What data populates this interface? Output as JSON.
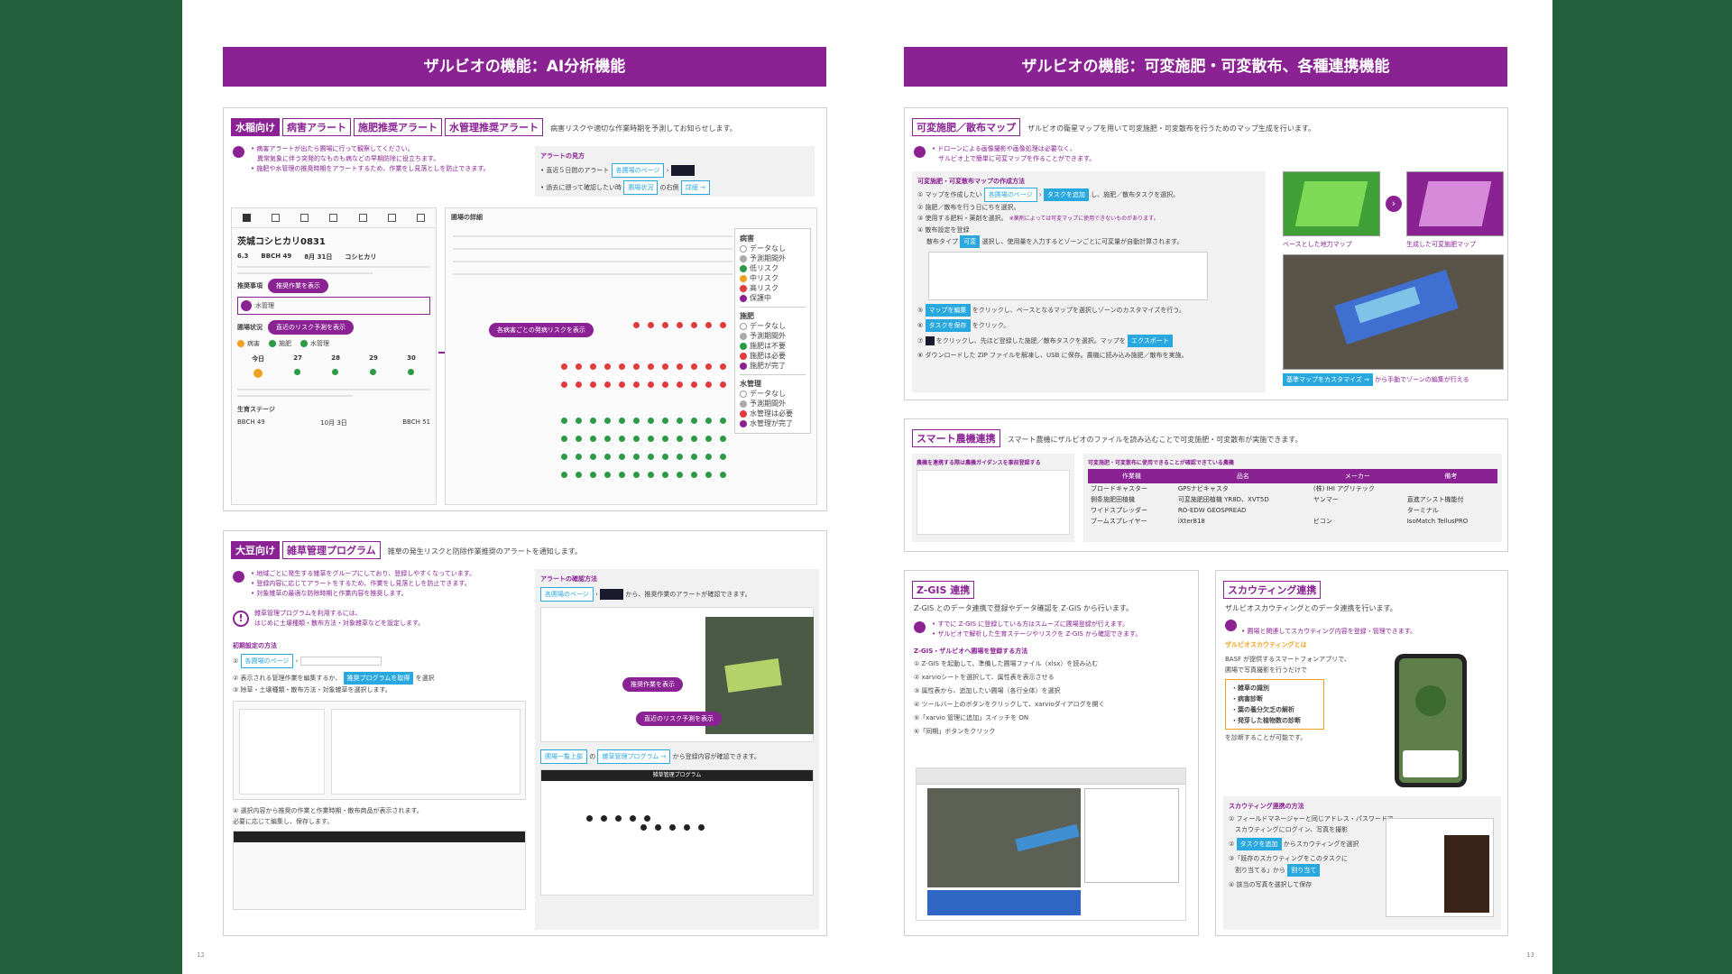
{
  "left": {
    "banner": "ザルビオの機能：AI分析機能",
    "rice": {
      "tags": [
        "水稲向け",
        "病害アラート",
        "施肥推奨アラート",
        "水管理推奨アラート"
      ],
      "desc": "病害リスクや適切な作業時期を予測してお知らせします。",
      "bullets": [
        "• 病害アラートが出たら圃場に行って観察してください。",
        "　異常気象に伴う突発的なものも病などの早期防除に役立ちます。",
        "• 施肥や水管理の推奨時期をアラートするため、作業をし見落としを防止できます。"
      ],
      "alert_title": "アラートの見方",
      "alert_step1": "• 直近５日間のアラート",
      "alert_step1_btn": "各圃場のページ",
      "alert_step2": "• 過去に遡って確認したい時",
      "alert_step2_btn": "圃場状況",
      "alert_step2_mid": "の右側",
      "alert_step2_btn2": "詳細 →",
      "phone": {
        "field_name": "茨城コシヒカリ0831",
        "stats": [
          "6.3",
          "BBCH 49",
          "8月 31日",
          "コシヒカリ"
        ],
        "section1": "推奨事項",
        "pill1": "推奨作業を表示",
        "task": "水管理",
        "section2": "圃場状況",
        "pill2": "直近のリスク予測を表示",
        "tabs": [
          "病害",
          "施肥",
          "水管理"
        ],
        "days": [
          "今日",
          "27",
          "28",
          "29",
          "30"
        ],
        "stage_title": "生育ステージ",
        "stage_left": "BBCH 49",
        "stage_right": "BBCH 51",
        "stage_date": "10月 3日"
      },
      "grid_title": "圃場の詳細",
      "grid_pill": "各病害ごとの発病リスクを表示",
      "legend": {
        "disease_title": "病害",
        "disease_items": [
          "データなし",
          "予測期間外",
          "低リスク",
          "中リスク",
          "高リスク",
          "保護中"
        ],
        "fert_title": "施肥",
        "fert_items": [
          "データなし",
          "予測期間外",
          "施肥は不要",
          "施肥は必要",
          "施肥が完了"
        ],
        "water_title": "水管理",
        "water_items": [
          "データなし",
          "予測期間外",
          "水管理は必要",
          "水管理が完了"
        ]
      }
    },
    "soy": {
      "tags": [
        "大豆向け",
        "雑草管理プログラム"
      ],
      "desc": "雑草の発生リスクと防除作業推奨のアラートを通知します。",
      "bullets": [
        "• 地域ごとに発生する雑草をグループにしており、登録しやすくなっています。",
        "• 登録内容に応じてアラートをするため、作業をし見落としを防止できます。",
        "• 対象雑草の最適な防除時期と作業内容を推奨します。"
      ],
      "warn_title": "雑草管理プログラムを利用するには、",
      "warn_body": "はじめに土壌種類・散布方法・対象雑草などを設定します。",
      "setup_title": "初期設定の方法",
      "step1_btn": "各圃場のページ",
      "step2": "② 表示される管理作業を編集するか、",
      "step2_btn": "推奨プログラムを取得",
      "step2_end": "を選択",
      "step3": "③ 除草・土壌種類・散布方法・対象雑草を選択します。",
      "step4": "④ 選択内容から推奨の作業と作業時期・散布商品が表示されます。",
      "step4b": "必要に応じて編集し、保存します。",
      "confirm_title": "アラートの確認方法",
      "confirm_btn": "各圃場のページ",
      "confirm_text": "から、推奨作業のアラートが確認できます。",
      "pill_a": "推奨作業を表示",
      "pill_b": "直近のリスク予測を表示",
      "list_btn": "圃場一覧上部",
      "list_btn2": "雑草管理プログラム →",
      "list_text": "から登録内容が確認できます。",
      "modal_title": "雑草管理プログラム",
      "page": "12"
    }
  },
  "right": {
    "banner": "ザルビオの機能：可変施肥・可変散布、各種連携機能",
    "vrt": {
      "tags": [
        "可変施肥／散布マップ"
      ],
      "desc": "ザルビオの衛星マップを用いて可変施肥・可変散布を行うためのマップ生成を行います。",
      "bullets": [
        "• ドローンによる画像撮影や画像処理は必要なく、",
        "　ザルビオ上で簡単に可変マップを作ることができます。"
      ],
      "how_title": "可変施肥・可変散布マップの作成方法",
      "s1": "① マップを作成したい",
      "s1_btn": "各圃場のページ",
      "s1_btn2": "タスクを追加",
      "s1_end": "し、施肥／散布タスクを選択。",
      "s2": "② 施肥／散布を行う日にちを選択。",
      "s3": "③ 使用する肥料・薬剤を選択。",
      "s3_note": "※薬剤によっては可変マップに使用できないものがあります。",
      "s4": "④ 散布設定を登録",
      "s4b": "散布タイプ",
      "s4_btn": "可変",
      "s4_end": "選択し、使用量を入力するとゾーンごとに可変量が自動計算されます。",
      "s5_btn": "マップを編集",
      "s5": "をクリックし、ベースとなるマップを選択しゾーンのカスタマイズを行う。",
      "s6_btn": "タスクを保存",
      "s6": "をクリック。",
      "s7": "をクリックし、先ほど登録した施肥／散布タスクを選択。マップを",
      "s7_btn": "エクスポート",
      "s8": "⑧ ダウンロードした ZIP ファイルを解凍し、USB に保存。農機に読み込み施肥／散布を実施。",
      "cap1": "ベースとした地力マップ",
      "cap2": "生成した可変施肥マップ",
      "cust_btn": "基準マップをカスタマイズ →",
      "cust_text": "から手動でゾーンの編集が行える"
    },
    "smart": {
      "tag": "スマート農機連携",
      "desc": "スマート農機にザルビオのファイルを読み込むことで可変施肥・可変散布が実施できます。",
      "left_title": "農機を連携する際は農機ガイダンスを事前登録する",
      "table_title": "可変施肥・可変散布に使用できることが確認できている農機",
      "headers": [
        "作業機",
        "品名",
        "メーカー",
        "備考"
      ],
      "rows": [
        [
          "ブロードキャスター",
          "GPSナビキャスタ",
          "(株) IHI アグリテック",
          ""
        ],
        [
          "側条施肥田植機",
          "可変施肥田植機 YR8D、XVT5D",
          "ヤンマー",
          "直進アシスト機能付"
        ],
        [
          "ワイドスプレッダー",
          "RO-EDW GEOSPREAD",
          "",
          "ターミナル"
        ],
        [
          "ブームスプレイヤー",
          "iXter818",
          "ビコン",
          "IsoMatch TellusPRO"
        ]
      ]
    },
    "zgis": {
      "tag": "Z-GIS 連携",
      "desc": "Z-GIS とのデータ連携で登録やデータ確認を Z-GIS から行います。",
      "bullets": [
        "• すでに Z-GIS に登録している方はスムーズに圃場登録が行えます。",
        "• ザルビオで解析した生育ステージやリスクを Z-GIS から確認できます。"
      ],
      "how_title": "Z-GIS・ザルビオへ圃場を登録する方法",
      "steps": [
        "① Z-GIS を起動して、準備した圃場ファイル（xlsx）を読み込む",
        "② xarvioシートを選択して、属性表を表示させる",
        "③ 属性表から、追加したい圃場（各行全体）を選択",
        "④ ツールバー上のボタンをクリックして、xarvioダイアログを開く",
        "⑤「xarvio 管理に追加」スイッチを ON",
        "⑥「同期」ボタンをクリック"
      ]
    },
    "scout": {
      "tag": "スカウティング連携",
      "desc": "ザルビオスカウティングとのデータ連携を行います。",
      "bullet": "• 圃場と関連してスカウティング内容を登録・管理できます。",
      "what": "ザルビオスカウティングとは",
      "what1": "BASF が提供するスマートフォンアプリで、",
      "what2": "圃場で写真撮影を行うだけで",
      "list": [
        "・雑草の識別",
        "・病害診断",
        "・葉の養分欠乏の解析",
        "・発芽した植物数の診断"
      ],
      "what3": "を診断することが可能です。",
      "how_title": "スカウティング連携の方法",
      "h1": "① フィールドマネージャーと同じアドレス・パスワードで",
      "h1b": "　スカウティングにログイン、写真を撮影",
      "h2_btn": "タスクを追加",
      "h2": "からスカウティングを選択",
      "h3": "③「既存のスカウティングをこのタスクに",
      "h3b": "　割り当てる」から",
      "h3_btn": "割り当て",
      "h4": "④ 該当の写真を選択して保存"
    },
    "page": "13"
  }
}
